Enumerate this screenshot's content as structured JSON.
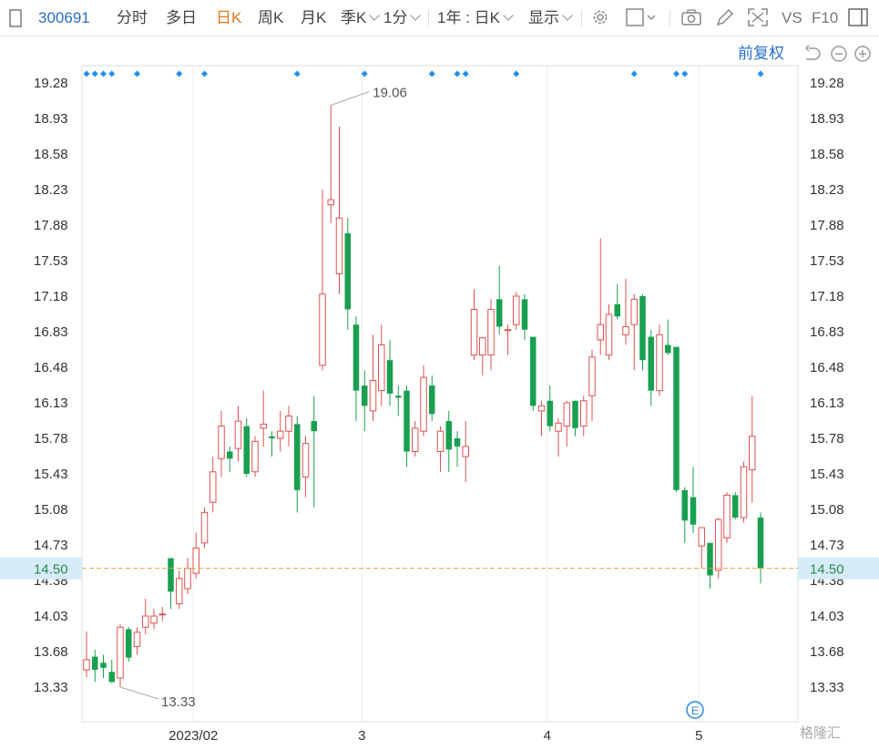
{
  "toolbar": {
    "code": "300691",
    "fenshi": "分时",
    "duori": "多日",
    "rik": "日K",
    "zhouk": "周K",
    "yuek": "月K",
    "jik": "季K",
    "yifen": "1分",
    "range": "1年 : 日K",
    "display": "显示",
    "vs": "VS",
    "f10": "F10"
  },
  "restore_label": "前复权",
  "watermark": "格隆汇",
  "colors": {
    "up": "#e05050",
    "down": "#18a050",
    "dot": "#1f8ef2",
    "price_line": "#f0a040",
    "price_badge_bg": "#d6ecfa",
    "price_text": "#2c8a4a"
  },
  "chart_data": {
    "type": "candlestick",
    "y_ticks": [
      "19.28",
      "18.93",
      "18.58",
      "18.23",
      "17.88",
      "17.53",
      "17.18",
      "16.83",
      "16.48",
      "16.13",
      "15.78",
      "15.43",
      "15.08",
      "14.73",
      "14.38",
      "14.03",
      "13.68",
      "13.33"
    ],
    "ylim": [
      13.08,
      19.46
    ],
    "x_ticks": [
      {
        "label": "2023/02",
        "index": 13
      },
      {
        "label": "3",
        "index": 33
      },
      {
        "label": "4",
        "index": 55
      },
      {
        "label": "5",
        "index": 73
      }
    ],
    "current_price": "14.50",
    "high_label": "19.06",
    "low_label": "13.33",
    "candles": [
      {
        "o": 13.5,
        "h": 13.88,
        "l": 13.43,
        "c": 13.6
      },
      {
        "o": 13.63,
        "h": 13.7,
        "l": 13.38,
        "c": 13.5
      },
      {
        "o": 13.57,
        "h": 13.65,
        "l": 13.42,
        "c": 13.52
      },
      {
        "o": 13.48,
        "h": 13.6,
        "l": 13.37,
        "c": 13.38
      },
      {
        "o": 13.42,
        "h": 13.95,
        "l": 13.33,
        "c": 13.92
      },
      {
        "o": 13.9,
        "h": 13.92,
        "l": 13.58,
        "c": 13.62
      },
      {
        "o": 13.73,
        "h": 13.92,
        "l": 13.65,
        "c": 13.87
      },
      {
        "o": 13.92,
        "h": 14.2,
        "l": 13.85,
        "c": 14.03
      },
      {
        "o": 13.96,
        "h": 14.1,
        "l": 13.9,
        "c": 14.03
      },
      {
        "o": 14.05,
        "h": 14.12,
        "l": 13.98,
        "c": 14.05
      },
      {
        "o": 14.6,
        "h": 14.6,
        "l": 14.1,
        "c": 14.27
      },
      {
        "o": 14.15,
        "h": 14.48,
        "l": 14.1,
        "c": 14.4
      },
      {
        "o": 14.3,
        "h": 14.6,
        "l": 14.25,
        "c": 14.5
      },
      {
        "o": 14.45,
        "h": 14.85,
        "l": 14.4,
        "c": 14.7
      },
      {
        "o": 14.75,
        "h": 15.1,
        "l": 14.7,
        "c": 15.05
      },
      {
        "o": 15.15,
        "h": 15.6,
        "l": 15.05,
        "c": 15.45
      },
      {
        "o": 15.58,
        "h": 16.05,
        "l": 15.4,
        "c": 15.9
      },
      {
        "o": 15.65,
        "h": 15.7,
        "l": 15.45,
        "c": 15.58
      },
      {
        "o": 15.68,
        "h": 16.1,
        "l": 15.55,
        "c": 15.95
      },
      {
        "o": 15.9,
        "h": 15.98,
        "l": 15.4,
        "c": 15.43
      },
      {
        "o": 15.45,
        "h": 15.8,
        "l": 15.4,
        "c": 15.75
      },
      {
        "o": 15.88,
        "h": 16.25,
        "l": 15.7,
        "c": 15.92
      },
      {
        "o": 15.8,
        "h": 15.85,
        "l": 15.6,
        "c": 15.78
      },
      {
        "o": 15.78,
        "h": 16.05,
        "l": 15.65,
        "c": 15.85
      },
      {
        "o": 15.85,
        "h": 16.1,
        "l": 15.7,
        "c": 16.0
      },
      {
        "o": 15.92,
        "h": 16.0,
        "l": 15.05,
        "c": 15.27
      },
      {
        "o": 15.4,
        "h": 15.8,
        "l": 15.2,
        "c": 15.73
      },
      {
        "o": 15.95,
        "h": 16.2,
        "l": 15.1,
        "c": 15.85
      },
      {
        "o": 16.5,
        "h": 18.23,
        "l": 16.45,
        "c": 17.2
      },
      {
        "o": 18.08,
        "h": 19.06,
        "l": 17.9,
        "c": 18.13
      },
      {
        "o": 17.4,
        "h": 18.85,
        "l": 17.2,
        "c": 17.95
      },
      {
        "o": 17.8,
        "h": 17.95,
        "l": 16.85,
        "c": 17.05
      },
      {
        "o": 16.9,
        "h": 16.98,
        "l": 15.95,
        "c": 16.25
      },
      {
        "o": 16.3,
        "h": 16.45,
        "l": 15.85,
        "c": 16.1
      },
      {
        "o": 16.05,
        "h": 16.8,
        "l": 15.95,
        "c": 16.35
      },
      {
        "o": 16.25,
        "h": 16.9,
        "l": 16.1,
        "c": 16.7
      },
      {
        "o": 16.55,
        "h": 16.75,
        "l": 16.1,
        "c": 16.22
      },
      {
        "o": 16.2,
        "h": 16.3,
        "l": 16.0,
        "c": 16.18
      },
      {
        "o": 16.25,
        "h": 16.3,
        "l": 15.5,
        "c": 15.65
      },
      {
        "o": 15.65,
        "h": 15.95,
        "l": 15.6,
        "c": 15.88
      },
      {
        "o": 15.85,
        "h": 16.5,
        "l": 15.8,
        "c": 16.38
      },
      {
        "o": 16.3,
        "h": 16.4,
        "l": 15.95,
        "c": 16.02
      },
      {
        "o": 15.65,
        "h": 15.9,
        "l": 15.45,
        "c": 15.85
      },
      {
        "o": 15.95,
        "h": 16.05,
        "l": 15.45,
        "c": 15.67
      },
      {
        "o": 15.78,
        "h": 15.85,
        "l": 15.5,
        "c": 15.7
      },
      {
        "o": 15.6,
        "h": 15.95,
        "l": 15.35,
        "c": 15.7
      },
      {
        "o": 16.6,
        "h": 17.25,
        "l": 16.55,
        "c": 17.05
      },
      {
        "o": 16.6,
        "h": 16.78,
        "l": 16.4,
        "c": 16.77
      },
      {
        "o": 16.6,
        "h": 17.15,
        "l": 16.45,
        "c": 17.05
      },
      {
        "o": 17.15,
        "h": 17.48,
        "l": 16.8,
        "c": 16.88
      },
      {
        "o": 16.85,
        "h": 16.9,
        "l": 16.6,
        "c": 16.85
      },
      {
        "o": 16.9,
        "h": 17.22,
        "l": 16.85,
        "c": 17.18
      },
      {
        "o": 17.15,
        "h": 17.2,
        "l": 16.75,
        "c": 16.85
      },
      {
        "o": 16.78,
        "h": 16.78,
        "l": 16.05,
        "c": 16.1
      },
      {
        "o": 16.05,
        "h": 16.15,
        "l": 15.8,
        "c": 16.1
      },
      {
        "o": 16.15,
        "h": 16.3,
        "l": 15.85,
        "c": 15.9
      },
      {
        "o": 15.85,
        "h": 15.98,
        "l": 15.6,
        "c": 15.93
      },
      {
        "o": 15.9,
        "h": 16.15,
        "l": 15.7,
        "c": 16.13
      },
      {
        "o": 16.15,
        "h": 16.15,
        "l": 15.8,
        "c": 15.88
      },
      {
        "o": 15.9,
        "h": 16.2,
        "l": 15.8,
        "c": 16.15
      },
      {
        "o": 16.2,
        "h": 16.65,
        "l": 15.95,
        "c": 16.58
      },
      {
        "o": 16.75,
        "h": 17.75,
        "l": 16.6,
        "c": 16.9
      },
      {
        "o": 16.6,
        "h": 17.1,
        "l": 16.55,
        "c": 17.0
      },
      {
        "o": 17.1,
        "h": 17.3,
        "l": 16.95,
        "c": 16.98
      },
      {
        "o": 16.8,
        "h": 17.35,
        "l": 16.7,
        "c": 16.88
      },
      {
        "o": 16.9,
        "h": 17.2,
        "l": 16.45,
        "c": 17.15
      },
      {
        "o": 17.18,
        "h": 17.2,
        "l": 16.45,
        "c": 16.55
      },
      {
        "o": 16.78,
        "h": 16.85,
        "l": 16.1,
        "c": 16.25
      },
      {
        "o": 16.25,
        "h": 16.9,
        "l": 16.2,
        "c": 16.8
      },
      {
        "o": 16.7,
        "h": 16.95,
        "l": 16.6,
        "c": 16.62
      },
      {
        "o": 16.68,
        "h": 16.68,
        "l": 15.25,
        "c": 15.27
      },
      {
        "o": 15.27,
        "h": 15.3,
        "l": 14.75,
        "c": 14.97
      },
      {
        "o": 15.2,
        "h": 15.5,
        "l": 14.85,
        "c": 14.93
      },
      {
        "o": 14.72,
        "h": 14.9,
        "l": 14.5,
        "c": 14.9
      },
      {
        "o": 14.75,
        "h": 14.75,
        "l": 14.3,
        "c": 14.43
      },
      {
        "o": 14.48,
        "h": 15.0,
        "l": 14.4,
        "c": 14.98
      },
      {
        "o": 14.8,
        "h": 15.25,
        "l": 14.75,
        "c": 15.22
      },
      {
        "o": 15.22,
        "h": 15.25,
        "l": 14.98,
        "c": 15.0
      },
      {
        "o": 15.0,
        "h": 15.55,
        "l": 14.95,
        "c": 15.5
      },
      {
        "o": 15.47,
        "h": 16.2,
        "l": 15.15,
        "c": 15.8
      },
      {
        "o": 15.0,
        "h": 15.05,
        "l": 14.35,
        "c": 14.5
      }
    ],
    "event_markers": [
      0,
      1,
      2,
      3,
      6,
      11,
      14,
      25,
      33,
      41,
      44,
      45,
      51,
      65,
      70,
      71,
      80
    ]
  }
}
